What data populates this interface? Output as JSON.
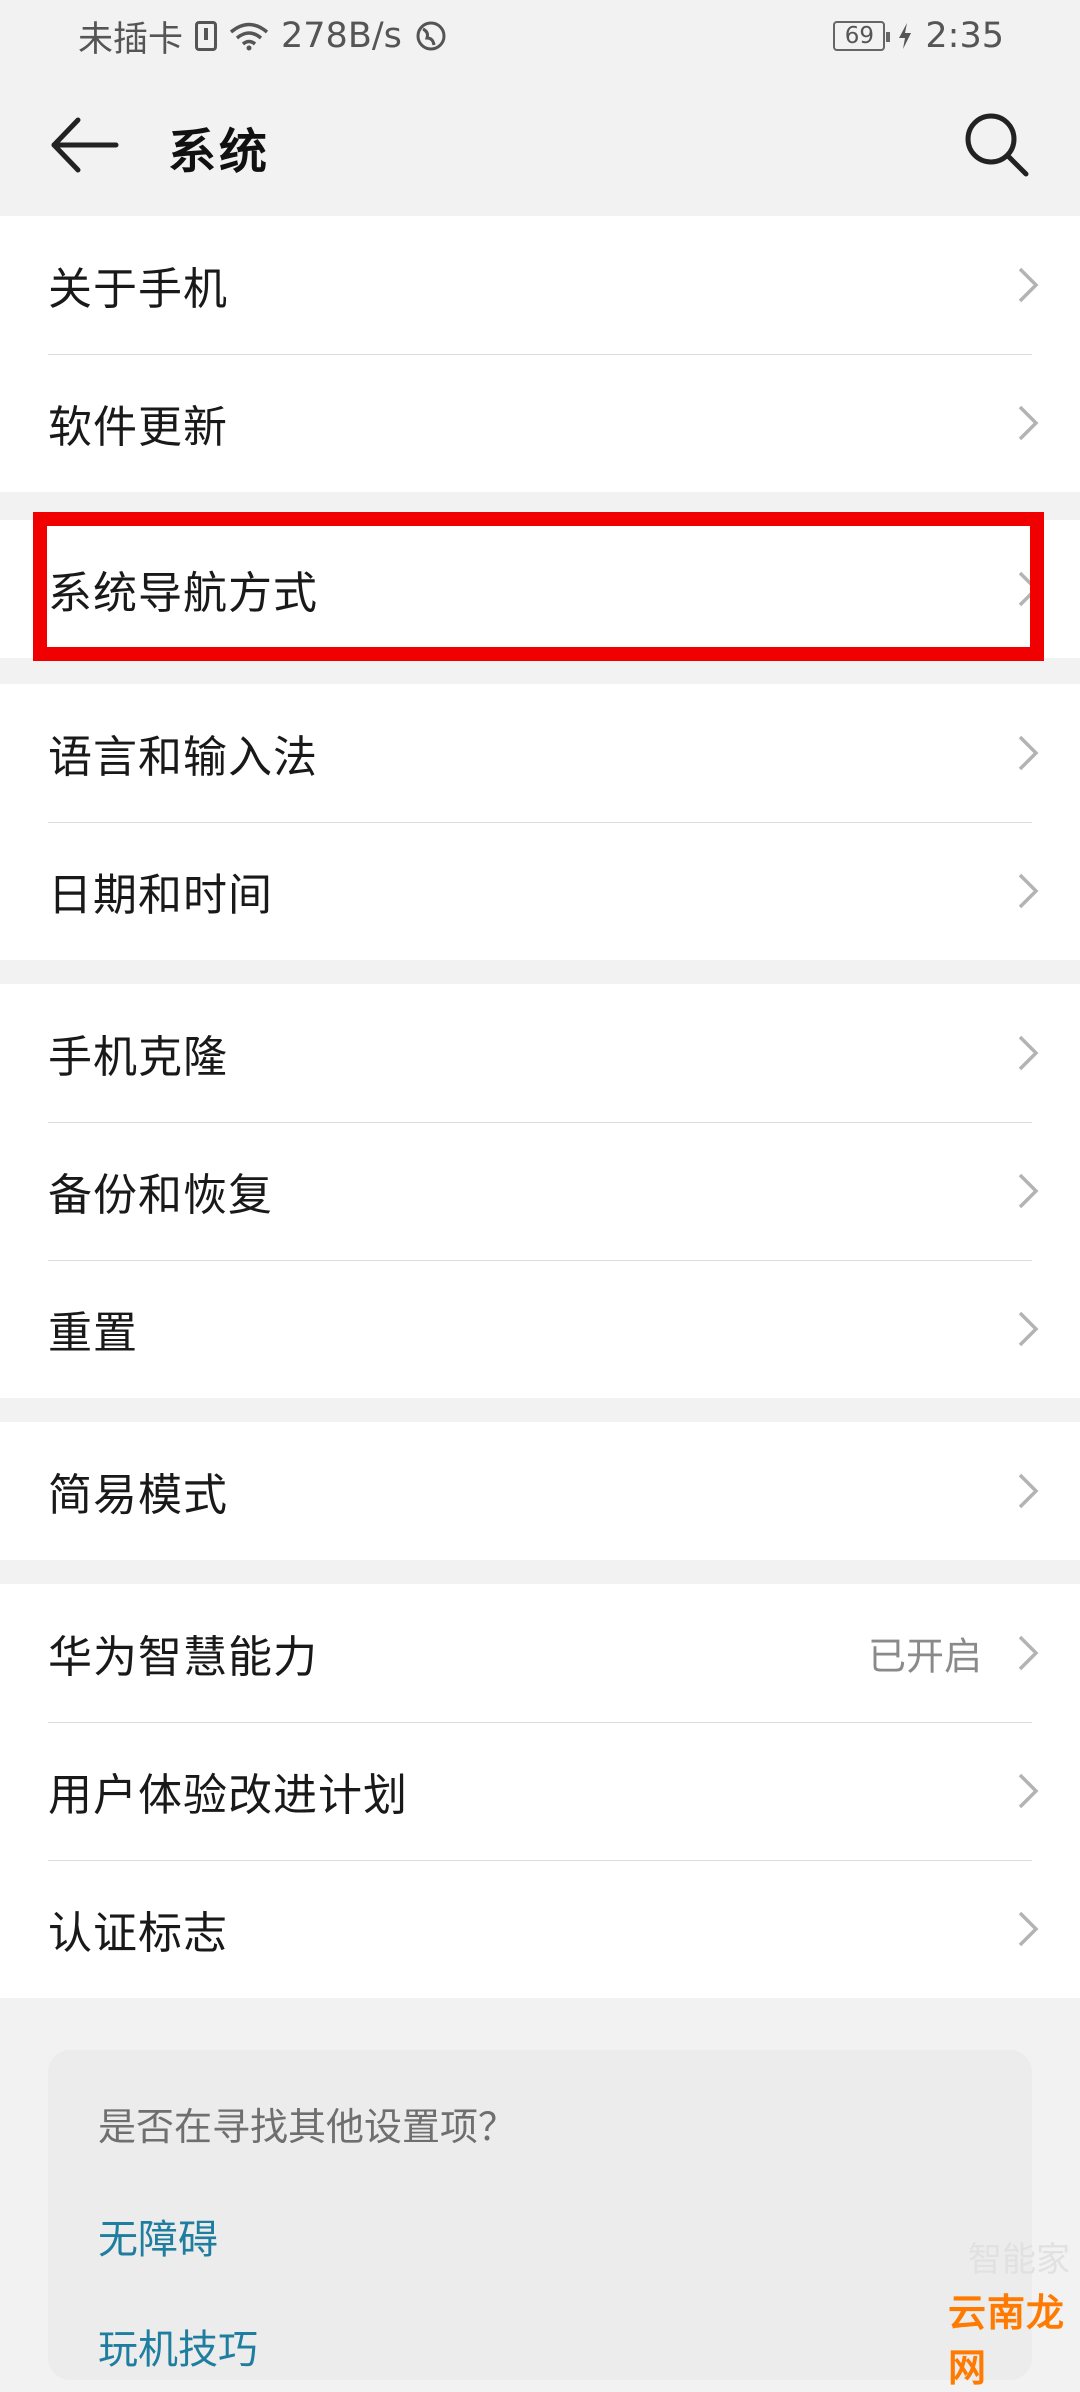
{
  "status": {
    "carrier": "未插卡",
    "speed": "278B/s",
    "battery": "69",
    "time": "2:35"
  },
  "header": {
    "title": "系统"
  },
  "groups": [
    {
      "items": [
        {
          "label": "关于手机"
        },
        {
          "label": "软件更新"
        }
      ]
    },
    {
      "items": [
        {
          "label": "系统导航方式"
        }
      ]
    },
    {
      "items": [
        {
          "label": "语言和输入法"
        },
        {
          "label": "日期和时间"
        }
      ]
    },
    {
      "items": [
        {
          "label": "手机克隆"
        },
        {
          "label": "备份和恢复"
        },
        {
          "label": "重置"
        }
      ]
    },
    {
      "items": [
        {
          "label": "简易模式"
        }
      ]
    },
    {
      "items": [
        {
          "label": "华为智慧能力",
          "value": "已开启"
        },
        {
          "label": "用户体验改进计划"
        },
        {
          "label": "认证标志"
        }
      ]
    }
  ],
  "tips": {
    "title": "是否在寻找其他设置项？",
    "links": [
      "无障碍",
      "玩机技巧"
    ]
  },
  "watermark": {
    "text": "云南龙网",
    "ghost": "智能家"
  },
  "colors": {
    "highlight": "#f00000",
    "link": "#1f7ea0",
    "background": "#f2f2f2"
  }
}
